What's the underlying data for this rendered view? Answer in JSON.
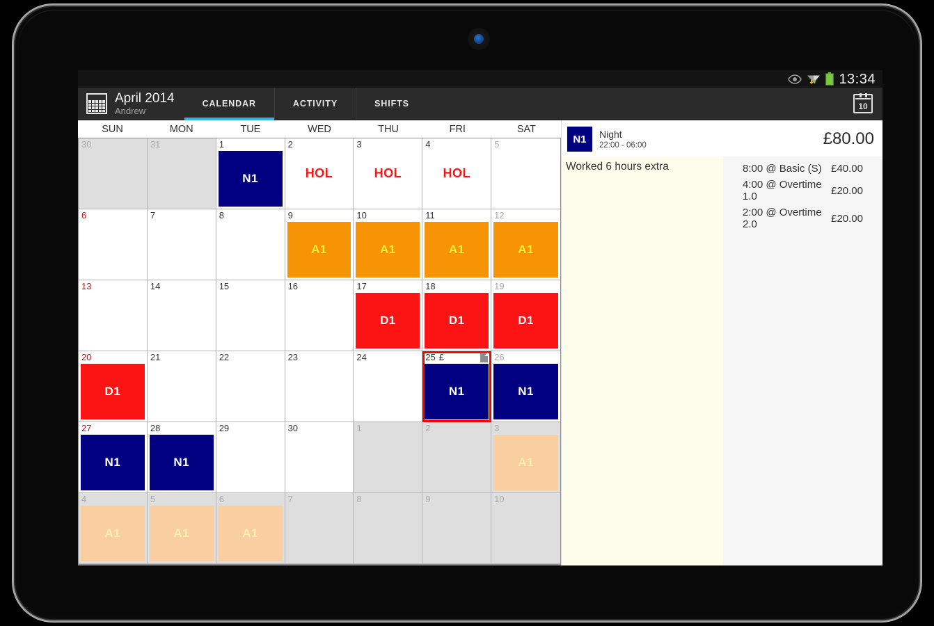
{
  "statusbar": {
    "icons": [
      "eye-icon",
      "wifi-icon",
      "battery-icon"
    ],
    "clock": "13:34"
  },
  "actionbar": {
    "app_icon": "calendar-icon",
    "title": "April 2014",
    "user": "Andrew",
    "tabs": [
      {
        "label": "CALENDAR",
        "active": true
      },
      {
        "label": "ACTIVITY",
        "active": false
      },
      {
        "label": "SHIFTS",
        "active": false
      }
    ],
    "goto_date_icon": "calendar-day-icon",
    "goto_date_number": "10",
    "accent_color": "#33b5e5"
  },
  "calendar": {
    "weekdays": [
      "SUN",
      "MON",
      "TUE",
      "WED",
      "THU",
      "FRI",
      "SAT"
    ],
    "colors": {
      "night": "#000080",
      "a1": "#f79406",
      "a1_text": "#ffee33",
      "d1": "#fc1414",
      "hol_text": "#ff1414",
      "out_of_month": "#dedede",
      "selection": "#ff0000",
      "a1_faded": "#f9cfa2"
    },
    "cells": [
      {
        "day": "30",
        "out": true,
        "dim": true
      },
      {
        "day": "31",
        "out": true,
        "dim": true
      },
      {
        "day": "1",
        "chip": "N1",
        "chip_type": "night"
      },
      {
        "day": "2",
        "chip": "HOL",
        "chip_type": "hol"
      },
      {
        "day": "3",
        "chip": "HOL",
        "chip_type": "hol"
      },
      {
        "day": "4",
        "chip": "HOL",
        "chip_type": "hol"
      },
      {
        "day": "5",
        "dim": true
      },
      {
        "day": "6",
        "sunday": true
      },
      {
        "day": "7"
      },
      {
        "day": "8"
      },
      {
        "day": "9",
        "chip": "A1",
        "chip_type": "a1"
      },
      {
        "day": "10",
        "chip": "A1",
        "chip_type": "a1"
      },
      {
        "day": "11",
        "chip": "A1",
        "chip_type": "a1"
      },
      {
        "day": "12",
        "dim": true,
        "chip": "A1",
        "chip_type": "a1"
      },
      {
        "day": "13",
        "sunday": true
      },
      {
        "day": "14"
      },
      {
        "day": "15"
      },
      {
        "day": "16"
      },
      {
        "day": "17",
        "chip": "D1",
        "chip_type": "d1"
      },
      {
        "day": "18",
        "chip": "D1",
        "chip_type": "d1"
      },
      {
        "day": "19",
        "dim": true,
        "chip": "D1",
        "chip_type": "d1"
      },
      {
        "day": "20",
        "sunday": true,
        "chip": "D1",
        "chip_type": "d1"
      },
      {
        "day": "21"
      },
      {
        "day": "22"
      },
      {
        "day": "23"
      },
      {
        "day": "24"
      },
      {
        "day": "25",
        "chip": "N1",
        "chip_type": "night",
        "selected": true,
        "pay_marker": "£",
        "note_icon": true
      },
      {
        "day": "26",
        "dim": true,
        "chip": "N1",
        "chip_type": "night"
      },
      {
        "day": "27",
        "sunday": true,
        "chip": "N1",
        "chip_type": "night"
      },
      {
        "day": "28",
        "chip": "N1",
        "chip_type": "night"
      },
      {
        "day": "29"
      },
      {
        "day": "30"
      },
      {
        "day": "1",
        "out": true,
        "dim": true
      },
      {
        "day": "2",
        "out": true,
        "dim": true
      },
      {
        "day": "3",
        "out": true,
        "dim": true,
        "chip": "A1",
        "chip_type": "a1-faded"
      },
      {
        "day": "4",
        "out": true,
        "dim": true,
        "chip": "A1",
        "chip_type": "a1-faded"
      },
      {
        "day": "5",
        "out": true,
        "dim": true,
        "chip": "A1",
        "chip_type": "a1-faded"
      },
      {
        "day": "6",
        "out": true,
        "dim": true,
        "chip": "A1",
        "chip_type": "a1-faded"
      },
      {
        "day": "7",
        "out": true,
        "dim": true
      },
      {
        "day": "8",
        "out": true,
        "dim": true
      },
      {
        "day": "9",
        "out": true,
        "dim": true
      },
      {
        "day": "10",
        "out": true,
        "dim": true
      }
    ]
  },
  "detail": {
    "badge": "N1",
    "shift_name": "Night",
    "shift_time": "22:00 - 06:00",
    "total": "£80.00",
    "note": "Worked 6 hours extra",
    "pay_rows": [
      {
        "desc": "8:00 @ Basic (S)",
        "amount": "£40.00"
      },
      {
        "desc": "4:00 @ Overtime 1.0",
        "amount": "£20.00"
      },
      {
        "desc": "2:00 @ Overtime 2.0",
        "amount": "£20.00"
      }
    ]
  }
}
